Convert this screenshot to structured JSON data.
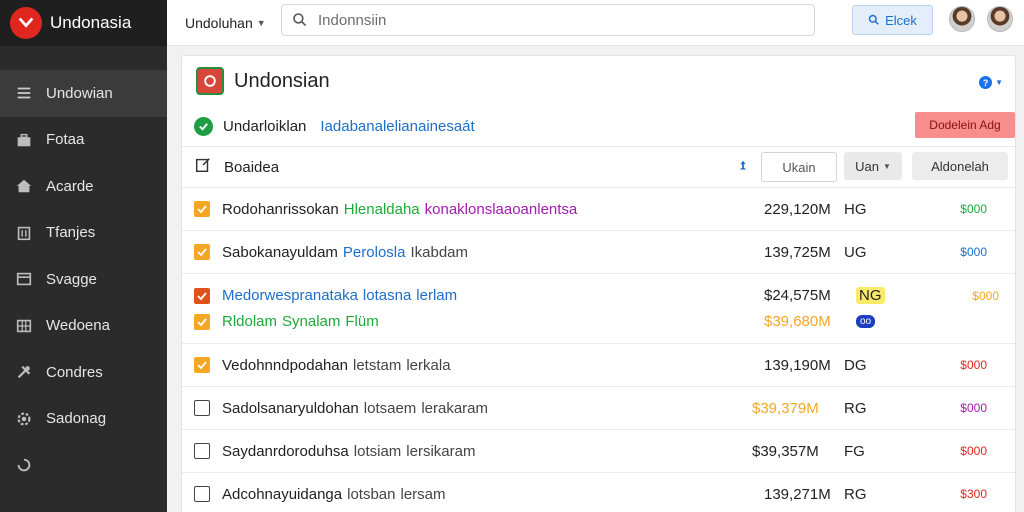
{
  "app": {
    "name": "Undonasia"
  },
  "sidebar": {
    "items": [
      {
        "label": "Undowian",
        "icon": "menu-icon"
      },
      {
        "label": "Fotaa",
        "icon": "briefcase-icon"
      },
      {
        "label": "Acarde",
        "icon": "home-icon"
      },
      {
        "label": "Tfanjes",
        "icon": "building-icon"
      },
      {
        "label": "Svagge",
        "icon": "window-icon"
      },
      {
        "label": "Wedoena",
        "icon": "grid-icon"
      },
      {
        "label": "Condres",
        "icon": "tools-icon"
      },
      {
        "label": "Sadonag",
        "icon": "gear-icon"
      }
    ]
  },
  "topbar": {
    "account_label": "Undoluhan",
    "search_placeholder": "Indonnsiin",
    "action_label": "Elcek"
  },
  "panel": {
    "title": "Undonsian",
    "status_label": "Undarloiklan",
    "status_link": "Iadabanalelianainesaát",
    "alert_button": "Dodelein Adg",
    "toolbar_label": "Boaidea",
    "filter_input": "Ukain",
    "select_value": "Uan",
    "toolbar_button": "Aldonelah"
  },
  "rows": [
    {
      "name": "Rodohanrissokan",
      "tag": "Hlenaldaha",
      "tag_color": "#1ea83a",
      "extra": "konaklonslaaoanlentsa",
      "extra_color": "#a21caf",
      "value": "229,120M",
      "value_color": "#222222",
      "code": "HG",
      "amount": "$000",
      "amount_color": "#1ea83a",
      "checked": true
    },
    {
      "name": "Sabokanayuldam",
      "tag": "Perolosla",
      "tag_color": "#1c6fc9",
      "extra": "Ikabdam",
      "extra_color": "#444444",
      "value": "139,725M",
      "value_color": "#222222",
      "code": "UG",
      "amount": "$000",
      "amount_color": "#1c6fc9",
      "checked": true
    },
    {
      "name": "Medorwespranataka",
      "tag": "lotasna",
      "tag_color": "#1c6fc9",
      "extra": "lerlam",
      "extra_color": "#1c6fc9",
      "value": "$24,575M",
      "value_color": "#222222",
      "code": "NG",
      "amount": "$000",
      "amount_color": "#f5a623",
      "checked": true
    },
    {
      "name": "Rldolam",
      "tag": "Synalam",
      "tag_color": "#1ea83a",
      "extra": "Flüm",
      "extra_color": "#1ea83a",
      "value": "$39,680M",
      "value_color": "#f5a623",
      "code": "",
      "amount": "",
      "amount_color": "#000000",
      "checked": true
    },
    {
      "name": "Vedohnndpodahan",
      "tag": "letstam",
      "tag_color": "#444444",
      "extra": "lerkala",
      "extra_color": "#444444",
      "value": "139,190M",
      "value_color": "#222222",
      "code": "DG",
      "amount": "$000",
      "amount_color": "#e0271f",
      "checked": true
    },
    {
      "name": "Sadolsanaryuldohan",
      "tag": "lotsaem",
      "tag_color": "#444444",
      "extra": "lerakaram",
      "extra_color": "#444444",
      "value": "$39,379M",
      "value_color": "#f5a623",
      "code": "RG",
      "amount": "$000",
      "amount_color": "#a21caf",
      "checked": false
    },
    {
      "name": "Saydanrdoroduhsa",
      "tag": "lotsiam",
      "tag_color": "#444444",
      "extra": "lersikaram",
      "extra_color": "#444444",
      "value": "$39,357M",
      "value_color": "#222222",
      "code": "FG",
      "amount": "$000",
      "amount_color": "#e0271f",
      "checked": false
    },
    {
      "name": "Adcohnayuidanga",
      "tag": "lotsban",
      "tag_color": "#444444",
      "extra": "lersam",
      "extra_color": "#444444",
      "value": "139,271M",
      "value_color": "#222222",
      "code": "RG",
      "amount": "$300",
      "amount_color": "#e0271f",
      "checked": false
    }
  ],
  "badges": {
    "row3_code": "NG",
    "row4_badge": "oo"
  },
  "colors": {
    "accent": "#1c6fc9",
    "sidebar_bg": "#2b2b2b",
    "brand_red": "#e0271f",
    "success": "#1e9e44"
  }
}
